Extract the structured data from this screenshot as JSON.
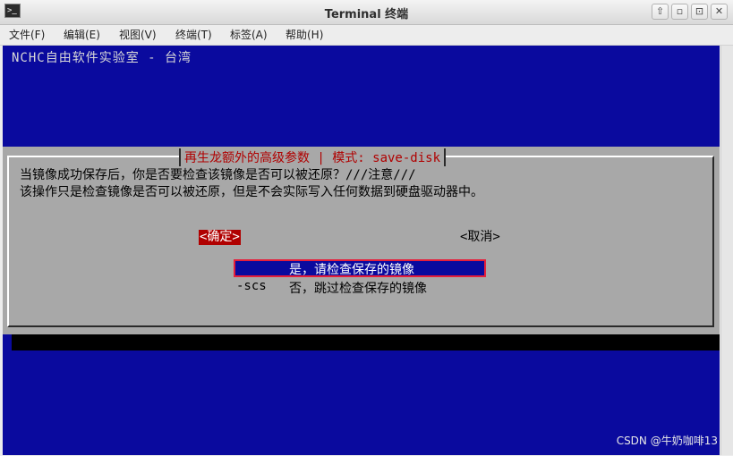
{
  "window": {
    "title": "Terminal 终端",
    "icon": "terminal-icon",
    "controls": [
      "⇧",
      "▫",
      "⊡",
      "✕"
    ]
  },
  "menu": [
    "文件(F)",
    "编辑(E)",
    "视图(V)",
    "终端(T)",
    "标签(A)",
    "帮助(H)"
  ],
  "terminal": {
    "banner": "NCHC自由软件实验室 - 台湾",
    "dialog_title": "再生龙额外的高级参数 | 模式: save-disk",
    "message_line1": "当镜像成功保存后，你是否要检查该镜像是否可以被还原？///注意///",
    "message_line2": "该操作只是检查镜像是否可以被还原，但是不会实际写入任何数据到硬盘驱动器中。",
    "options": [
      {
        "tag": "",
        "label": "是，请检查保存的镜像",
        "selected": true
      },
      {
        "tag": "-scs",
        "label": "否，跳过检查保存的镜像",
        "selected": false
      }
    ],
    "ok_label": "<确定>",
    "cancel_label": "<取消>"
  },
  "watermark": "CSDN @牛奶咖啡13",
  "colors": {
    "terminal_bg": "#0a0a9e",
    "dialog_bg": "#a8a8a8",
    "title_red": "#b00000",
    "selection_border": "#e61e3a"
  }
}
